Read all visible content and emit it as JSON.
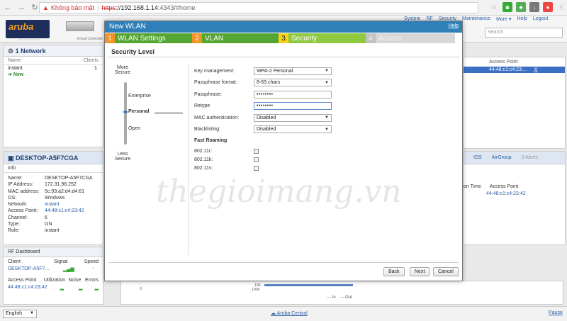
{
  "browser": {
    "security_label": "Không bảo mật",
    "url_scheme": "https",
    "url_host": "://192.168.1.14",
    "url_rest": ":4343/#home"
  },
  "app": {
    "top_links": [
      "System",
      "RF",
      "Security",
      "Maintenance",
      "More ▾",
      "Help",
      "Logout"
    ],
    "search_placeholder": "Search",
    "logo_text": "aruba",
    "logo_sub": "NETWORKS",
    "vc_label": "Virtual Controller"
  },
  "network_panel": {
    "title": "1 Network",
    "col_name": "Name",
    "col_clients": "Clients",
    "rows": [
      {
        "name": "instant",
        "clients": "1"
      }
    ],
    "new_label": "New"
  },
  "ap_panel": {
    "header": "Access Point",
    "row_value": "44:48:c1:c4:23:...",
    "row_mark": "X"
  },
  "client_panel": {
    "title": "DESKTOP-A5F7CGA",
    "info_title": "Info",
    "rows": [
      {
        "k": "Name:",
        "v": "DESKTOP-A5F7CGA"
      },
      {
        "k": "IP Address:",
        "v": "172.31.98.252"
      },
      {
        "k": "MAC address:",
        "v": "5c:93:a2:d4:d4:61"
      },
      {
        "k": "OS:",
        "v": "Windows"
      },
      {
        "k": "Network:",
        "v": "instant"
      },
      {
        "k": "Access Point:",
        "v": "44:48:c1:c4:23:42"
      },
      {
        "k": "Channel:",
        "v": "6"
      },
      {
        "k": "Type:",
        "v": "GN"
      },
      {
        "k": "Role:",
        "v": "instant"
      }
    ]
  },
  "ids_panel": {
    "tab1": "IDS",
    "tab2": "AirGroup",
    "tab3": "0 Alerts",
    "head1": "on Time",
    "head2": "Access Point",
    "row": "44:48:c1:c4:23:42"
  },
  "rf_panel": {
    "title": "RF Dashboard",
    "h_client": "Client",
    "h_signal": "Signal",
    "h_speed": "Speed",
    "client_value": "DESKTOP-A5F7...",
    "h_ap": "Access Point",
    "h_util": "Utilization",
    "h_noise": "Noise",
    "h_errors": "Errors",
    "ap_value": "44:48:c1:c4:23:42"
  },
  "bottom_chart": {
    "tick_0": "0",
    "tick_10k": "10K",
    "tick_100k": "100K",
    "legend_in": "In",
    "legend_out": "Out"
  },
  "status_bar": {
    "language": "English",
    "aruba_central": "Aruba Central",
    "pause": "Pause"
  },
  "modal": {
    "title": "New WLAN",
    "help": "Help",
    "steps": [
      {
        "num": "1",
        "label": "WLAN Settings"
      },
      {
        "num": "2",
        "label": "VLAN"
      },
      {
        "num": "3",
        "label": "Security"
      },
      {
        "num": "4",
        "label": "Access"
      }
    ],
    "section_title": "Security Level",
    "more_secure": "More Secure",
    "less_secure": "Less Secure",
    "levels": [
      "Enterprise",
      "Personal",
      "Open"
    ],
    "fields": {
      "key_mgmt_label": "Key management:",
      "key_mgmt_value": "WPA-2 Personal",
      "pass_format_label": "Passphrase format:",
      "pass_format_value": "8-63 chars",
      "passphrase_label": "Passphrase:",
      "passphrase_value": "••••••••",
      "retype_label": "Retype",
      "retype_value": "••••••••",
      "mac_auth_label": "MAC authentication:",
      "mac_auth_value": "Disabled",
      "blacklisting_label": "Blacklisting:",
      "blacklisting_value": "Disabled"
    },
    "fast_roaming": {
      "title": "Fast Roaming",
      "r": "802.11r:",
      "k": "802.11k:",
      "v": "802.11v:"
    },
    "buttons": {
      "back": "Back",
      "next": "Next",
      "cancel": "Cancel"
    }
  },
  "watermark": "thegioimang.vn",
  "colors": {
    "modal_header": "#2f7fb8",
    "step_done": "#55a533",
    "step_current": "#8fc93f",
    "step_future": "#d7d7d7",
    "step_num_done": "#f39322",
    "step_num_current": "#f7d11b"
  }
}
